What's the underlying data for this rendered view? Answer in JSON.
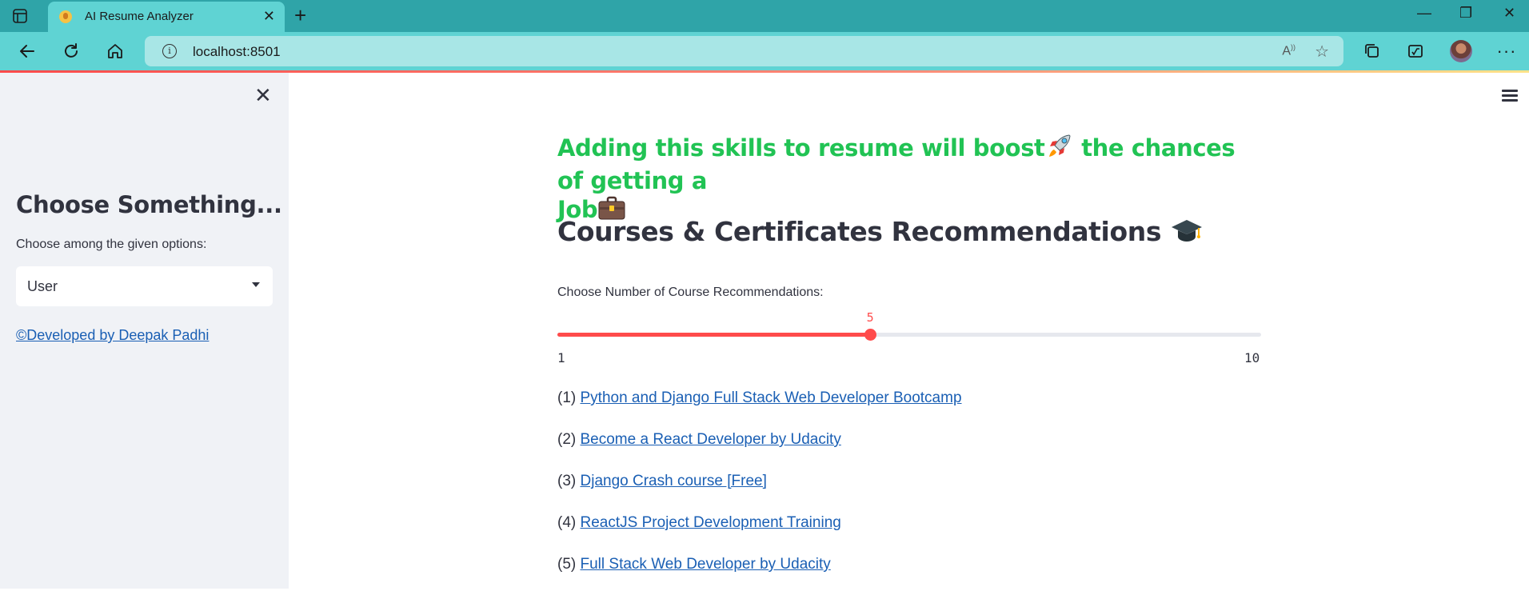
{
  "browser": {
    "tab_title": "AI Resume Analyzer",
    "url": "localhost:8501"
  },
  "sidebar": {
    "title": "Choose Something...",
    "select_label": "Choose among the given options:",
    "select_value": "User",
    "credit_link": "©Developed by Deepak Padhi"
  },
  "main": {
    "skills_message": "Adding this skills to resume will boost",
    "skills_message_2": " the chances of getting a",
    "skills_message_3": "Job",
    "courses_heading": "Courses & Certificates Recommendations",
    "slider": {
      "label": "Choose Number of Course Recommendations:",
      "value": 5,
      "min": 1,
      "max": 10,
      "accent_color": "#ff4b4b"
    },
    "courses": [
      {
        "index": "(1) ",
        "title": "Python and Django Full Stack Web Developer Bootcamp"
      },
      {
        "index": "(2) ",
        "title": "Become a React Developer by Udacity"
      },
      {
        "index": "(3) ",
        "title": "Django Crash course [Free]"
      },
      {
        "index": "(4) ",
        "title": "ReactJS Project Development Training"
      },
      {
        "index": "(5) ",
        "title": "Full Stack Web Developer by Udacity"
      }
    ]
  },
  "colors": {
    "success_green": "#21c354",
    "link_blue": "#1a5fb4",
    "sidebar_bg": "#f0f2f6",
    "titlebar_bg": "#2fa4a8",
    "toolbar_bg": "#5fd3d3"
  },
  "icons": [
    "rocket-icon",
    "briefcase-icon",
    "graduation-cap-icon",
    "close-icon",
    "hamburger-menu-icon"
  ]
}
